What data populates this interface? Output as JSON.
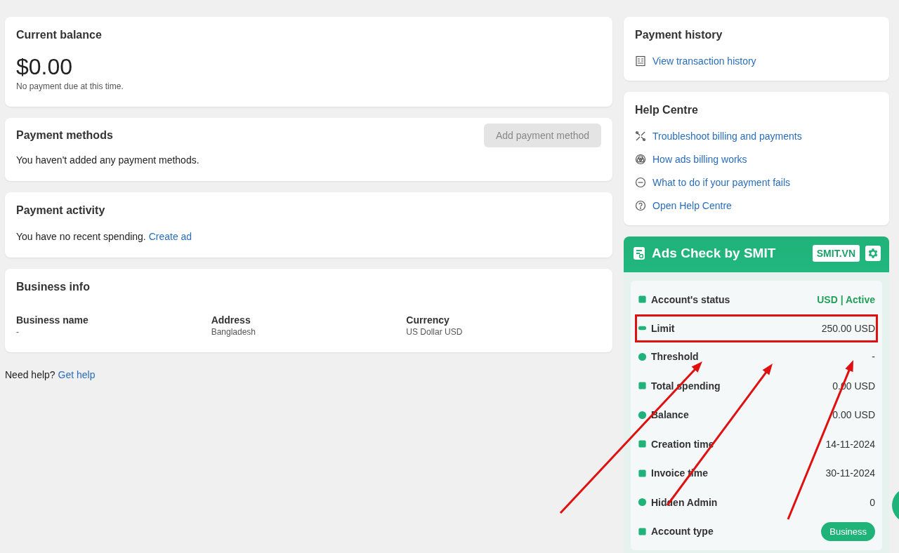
{
  "balance_card": {
    "title": "Current balance",
    "amount": "$0.00",
    "note": "No payment due at this time."
  },
  "payment_methods": {
    "title": "Payment methods",
    "button": {
      "label": "Add payment method",
      "disabled": true
    },
    "text": "You haven't added any payment methods."
  },
  "payment_activity": {
    "title": "Payment activity",
    "text": "You have no recent spending.",
    "link": "Create ad"
  },
  "business_info": {
    "title": "Business info",
    "fields": [
      {
        "label": "Business name",
        "value": "-"
      },
      {
        "label": "Address",
        "value": "Bangladesh"
      },
      {
        "label": "Currency",
        "value": "US Dollar USD"
      }
    ]
  },
  "help_footer": {
    "text": "Need help?",
    "link": "Get help"
  },
  "payment_history": {
    "title": "Payment history",
    "links": [
      {
        "label": "View transaction history"
      }
    ]
  },
  "help_centre": {
    "title": "Help Centre",
    "links": [
      {
        "label": "Troubleshoot billing and payments"
      },
      {
        "label": "How ads billing works"
      },
      {
        "label": "What to do if your payment fails"
      },
      {
        "label": "Open Help Centre"
      }
    ]
  },
  "ads_check": {
    "title": "Ads Check by SMIT",
    "site_button": "SMIT.VN",
    "rows": [
      {
        "label": "Account's status",
        "value": "USD | Active",
        "kind": "status",
        "highlighted": false
      },
      {
        "label": "Limit",
        "value": "250.00 USD",
        "kind": "text",
        "highlighted": true
      },
      {
        "label": "Threshold",
        "value": "-",
        "kind": "text",
        "highlighted": false
      },
      {
        "label": "Total spending",
        "value": "0.00 USD",
        "kind": "text",
        "highlighted": false
      },
      {
        "label": "Balance",
        "value": "0.00 USD",
        "kind": "text",
        "highlighted": false
      },
      {
        "label": "Creation time",
        "value": "14-11-2024",
        "kind": "text",
        "highlighted": false
      },
      {
        "label": "Invoice time",
        "value": "30-11-2024",
        "kind": "text",
        "highlighted": false
      },
      {
        "label": "Hidden Admin",
        "value": "0",
        "kind": "text",
        "highlighted": false
      },
      {
        "label": "Account type",
        "value": "Business",
        "kind": "badge",
        "highlighted": false
      }
    ]
  }
}
